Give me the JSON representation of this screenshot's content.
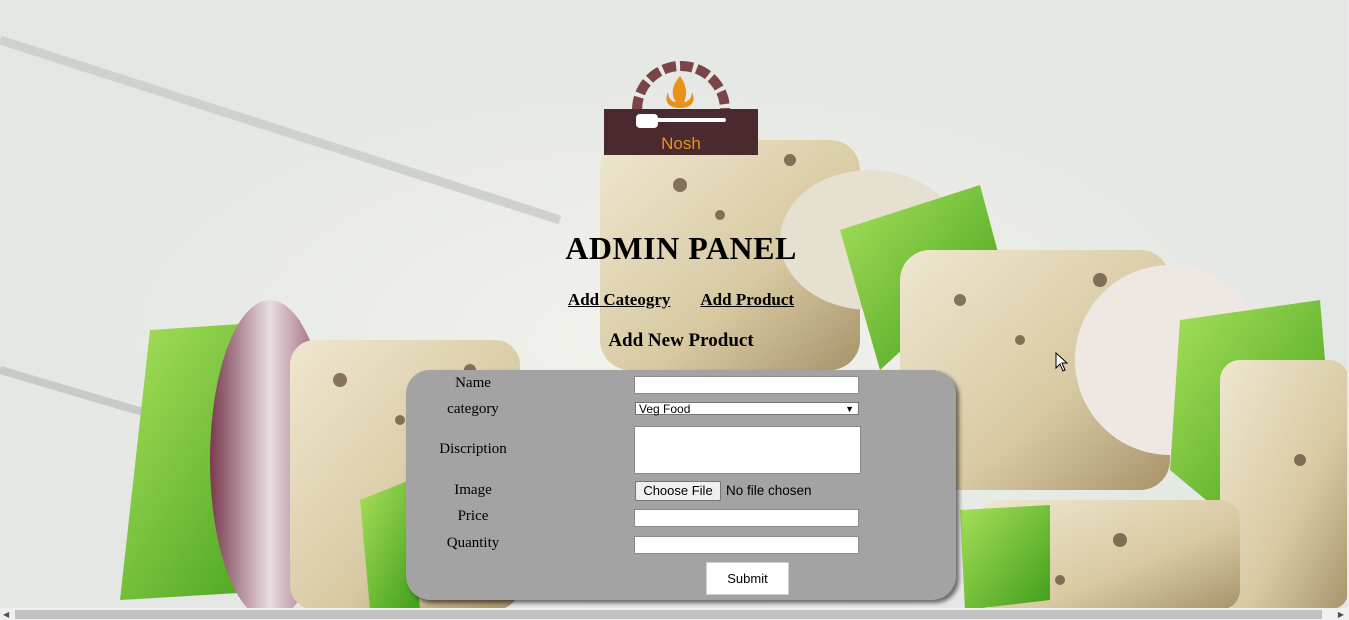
{
  "logo": {
    "brand_text": "Nosh"
  },
  "page": {
    "title": "ADMIN PANEL",
    "subtitle": "Add New Product"
  },
  "nav": {
    "add_category": "Add Cateogry",
    "add_product": "Add Product"
  },
  "form": {
    "name_label": "Name",
    "category_label": "category",
    "category_value": "Veg Food",
    "description_label": "Discription",
    "image_label": "Image",
    "file_button": "Choose File",
    "file_status": "No file chosen",
    "price_label": "Price",
    "quantity_label": "Quantity",
    "submit_label": "Submit"
  },
  "colors": {
    "panel": "#a3a3a3",
    "logo_bg": "#4a2a2e",
    "logo_accent": "#e8921c"
  }
}
